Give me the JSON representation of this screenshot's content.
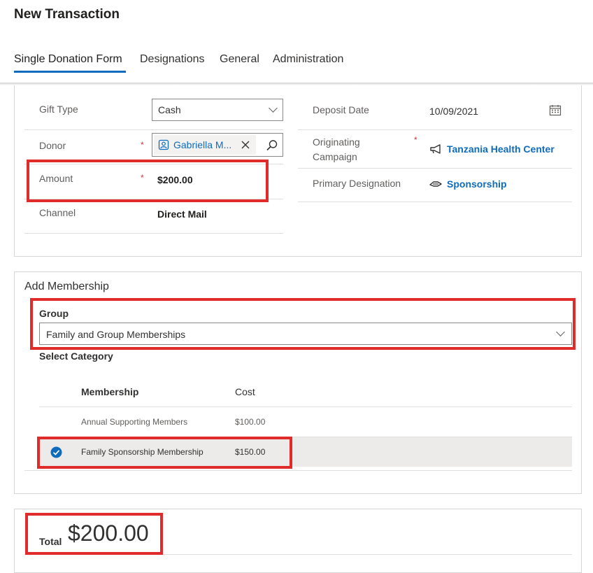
{
  "header": {
    "title": "New Transaction",
    "tabs": [
      "Single Donation Form",
      "Designations",
      "General",
      "Administration"
    ]
  },
  "form": {
    "gift_type_label": "Gift Type",
    "gift_type_value": "Cash",
    "donor_label": "Donor",
    "donor_value": "Gabriella M...",
    "amount_label": "Amount",
    "amount_value": "$200.00",
    "channel_label": "Channel",
    "channel_value": "Direct Mail",
    "deposit_date_label": "Deposit Date",
    "deposit_date_value": "10/09/2021",
    "originating_campaign_label": "Originating Campaign",
    "originating_campaign_value": "Tanzania Health Center",
    "primary_designation_label": "Primary Designation",
    "primary_designation_value": "Sponsorship",
    "required_mark": "*"
  },
  "membership": {
    "title": "Add Membership",
    "group_label": "Group",
    "group_value": "Family and Group Memberships",
    "category_label": "Select Category",
    "col_membership": "Membership",
    "col_cost": "Cost",
    "rows": [
      {
        "name": "Annual Supporting Members",
        "cost": "$100.00",
        "selected": false
      },
      {
        "name": "Family Sponsorship Membership",
        "cost": "$150.00",
        "selected": true
      }
    ]
  },
  "total": {
    "label": "Total",
    "value": "$200.00"
  },
  "colors": {
    "accent": "#0f6cbd",
    "required": "#d13438",
    "highlight_box": "#e02b2b",
    "selected_row": "#edebe9"
  }
}
